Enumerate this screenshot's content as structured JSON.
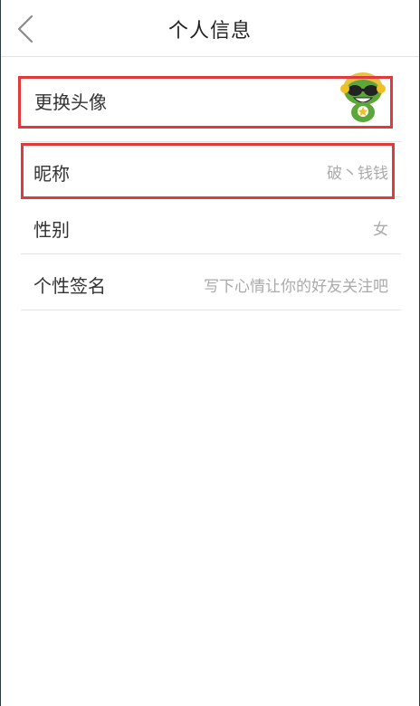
{
  "header": {
    "back_icon": "chevron-left-icon",
    "title": "个人信息"
  },
  "profile": {
    "avatar": {
      "label": "更换头像",
      "icon": "frog-avatar-icon"
    },
    "nickname": {
      "label": "昵称",
      "value": "破丶钱钱"
    },
    "gender": {
      "label": "性别",
      "value": "女"
    },
    "signature": {
      "label": "个性签名",
      "placeholder": "写下心情让你的好友关注吧"
    }
  },
  "colors": {
    "highlight": "#e03a3a",
    "divider": "#e4e4e4",
    "label_text": "#333333",
    "value_text": "#aaaaaa"
  }
}
